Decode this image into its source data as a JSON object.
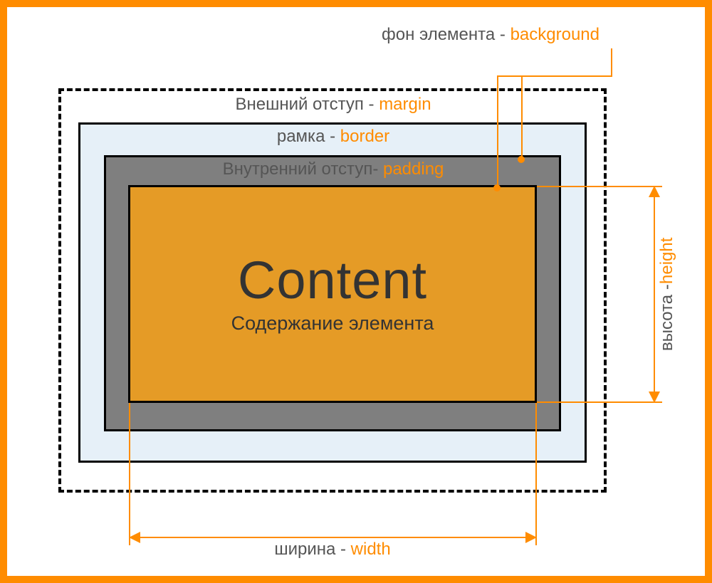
{
  "title": {
    "text": "фон элемента - ",
    "kw": "background"
  },
  "layers": {
    "margin": {
      "text": "Внешний отступ - ",
      "kw": "margin"
    },
    "border": {
      "text": "рамка - ",
      "kw": "border"
    },
    "padding": {
      "text": "Внутренний отступ- ",
      "kw": "padding"
    }
  },
  "content": {
    "big": "Content",
    "sub": "Содержание элемента"
  },
  "dims": {
    "width": {
      "text": "ширина - ",
      "kw": "width"
    },
    "height": {
      "text": "высота - ",
      "kw": "height"
    }
  }
}
